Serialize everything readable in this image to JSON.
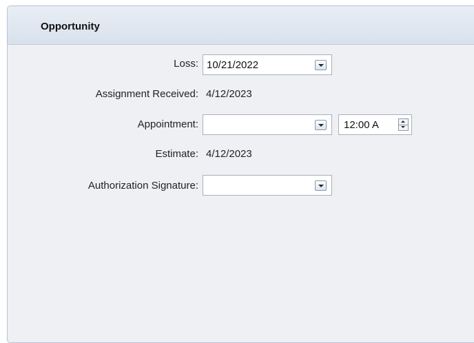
{
  "panel": {
    "title": "Opportunity"
  },
  "fields": {
    "loss": {
      "label": "Loss:",
      "value": "10/21/2022"
    },
    "assignment_received": {
      "label": "Assignment Received:",
      "value": "4/12/2023"
    },
    "appointment": {
      "label": "Appointment:",
      "date_value": "",
      "time_value": "12:00 A"
    },
    "estimate": {
      "label": "Estimate:",
      "value": "4/12/2023"
    },
    "authorization_signature": {
      "label": "Authorization Signature:",
      "value": ""
    }
  },
  "colors": {
    "panel_background": "#eef0f4",
    "header_gradient_top": "#e9eef5",
    "header_gradient_bottom": "#d8e1ec",
    "border": "#b9c3d1"
  }
}
